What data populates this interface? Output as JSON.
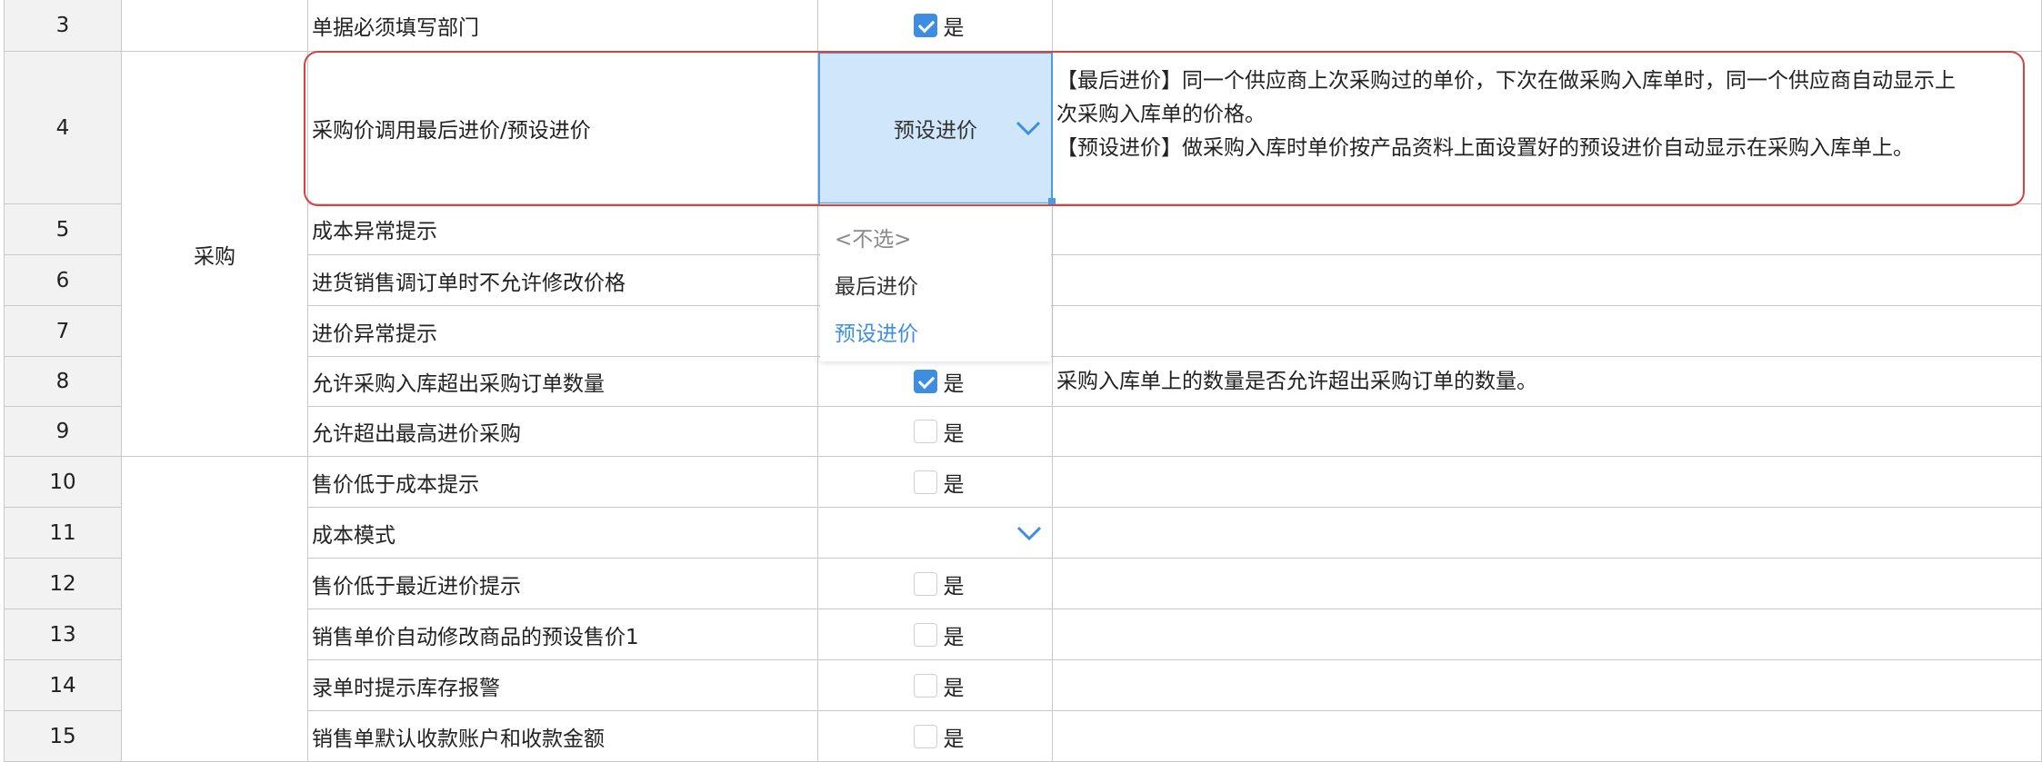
{
  "category_purchase": "采购",
  "rows": [
    {
      "num": "3",
      "name": "单据必须填写部门",
      "checked": true,
      "desc": ""
    },
    {
      "num": "4",
      "name": "采购价调用最后进价/预设进价",
      "select_value": "预设进价",
      "desc_lines": [
        "【最后进价】同一个供应商上次采购过的单价，下次在做采购入库单时，同一个供应商自动显示上",
        "次采购入库单的价格。",
        "【预设进价】做采购入库时单价按产品资料上面设置好的预设进价自动显示在采购入库单上。"
      ]
    },
    {
      "num": "5",
      "name": "成本异常提示"
    },
    {
      "num": "6",
      "name": "进货销售调订单时不允许修改价格"
    },
    {
      "num": "7",
      "name": "进价异常提示"
    },
    {
      "num": "8",
      "name": "允许采购入库超出采购订单数量",
      "checked": true,
      "desc": "采购入库单上的数量是否允许超出采购订单的数量。"
    },
    {
      "num": "9",
      "name": "允许超出最高进价采购",
      "checked": false
    },
    {
      "num": "10",
      "name": "售价低于成本提示",
      "checked": false
    },
    {
      "num": "11",
      "name": "成本模式"
    },
    {
      "num": "12",
      "name": "售价低于最近进价提示",
      "checked": false
    },
    {
      "num": "13",
      "name": "销售单价自动修改商品的预设售价1",
      "checked": false
    },
    {
      "num": "14",
      "name": "录单时提示库存报警",
      "checked": false
    },
    {
      "num": "15",
      "name": "销售单默认收款账户和收款金额",
      "checked": false
    }
  ],
  "checkbox_label": "是",
  "dropdown": {
    "options": [
      "<不选>",
      "最后进价",
      "预设进价"
    ],
    "selected": "预设进价"
  },
  "colors": {
    "accent": "#3d8ee0",
    "selected_bg": "#cfe6fb",
    "highlight": "#d94040"
  }
}
